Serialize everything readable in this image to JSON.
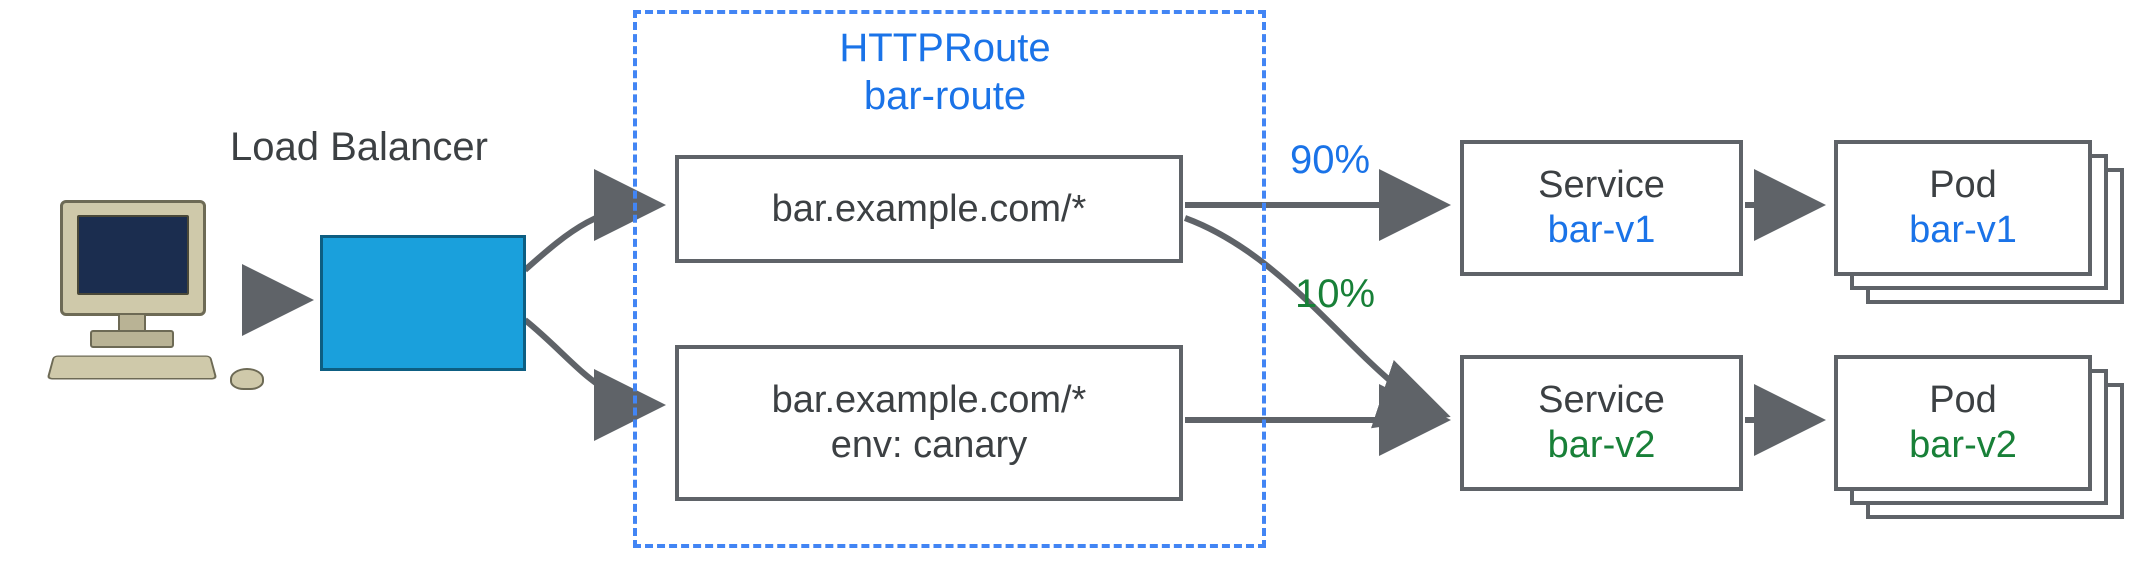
{
  "load_balancer": {
    "title": "Load Balancer"
  },
  "httproute": {
    "heading_line1": "HTTPRoute",
    "heading_line2": "bar-route",
    "rule1": {
      "match": "bar.example.com/*"
    },
    "rule2": {
      "match": "bar.example.com/*",
      "header": "env: canary"
    },
    "weights": {
      "primary": "90%",
      "canary": "10%"
    }
  },
  "services": {
    "v1": {
      "kind": "Service",
      "name": "bar-v1"
    },
    "v2": {
      "kind": "Service",
      "name": "bar-v2"
    }
  },
  "pods": {
    "v1": {
      "kind": "Pod",
      "name": "bar-v1"
    },
    "v2": {
      "kind": "Pod",
      "name": "bar-v2"
    }
  },
  "colors": {
    "blue": "#1a73e8",
    "green": "#188038",
    "gray": "#5f6368",
    "text": "#3c4043"
  }
}
